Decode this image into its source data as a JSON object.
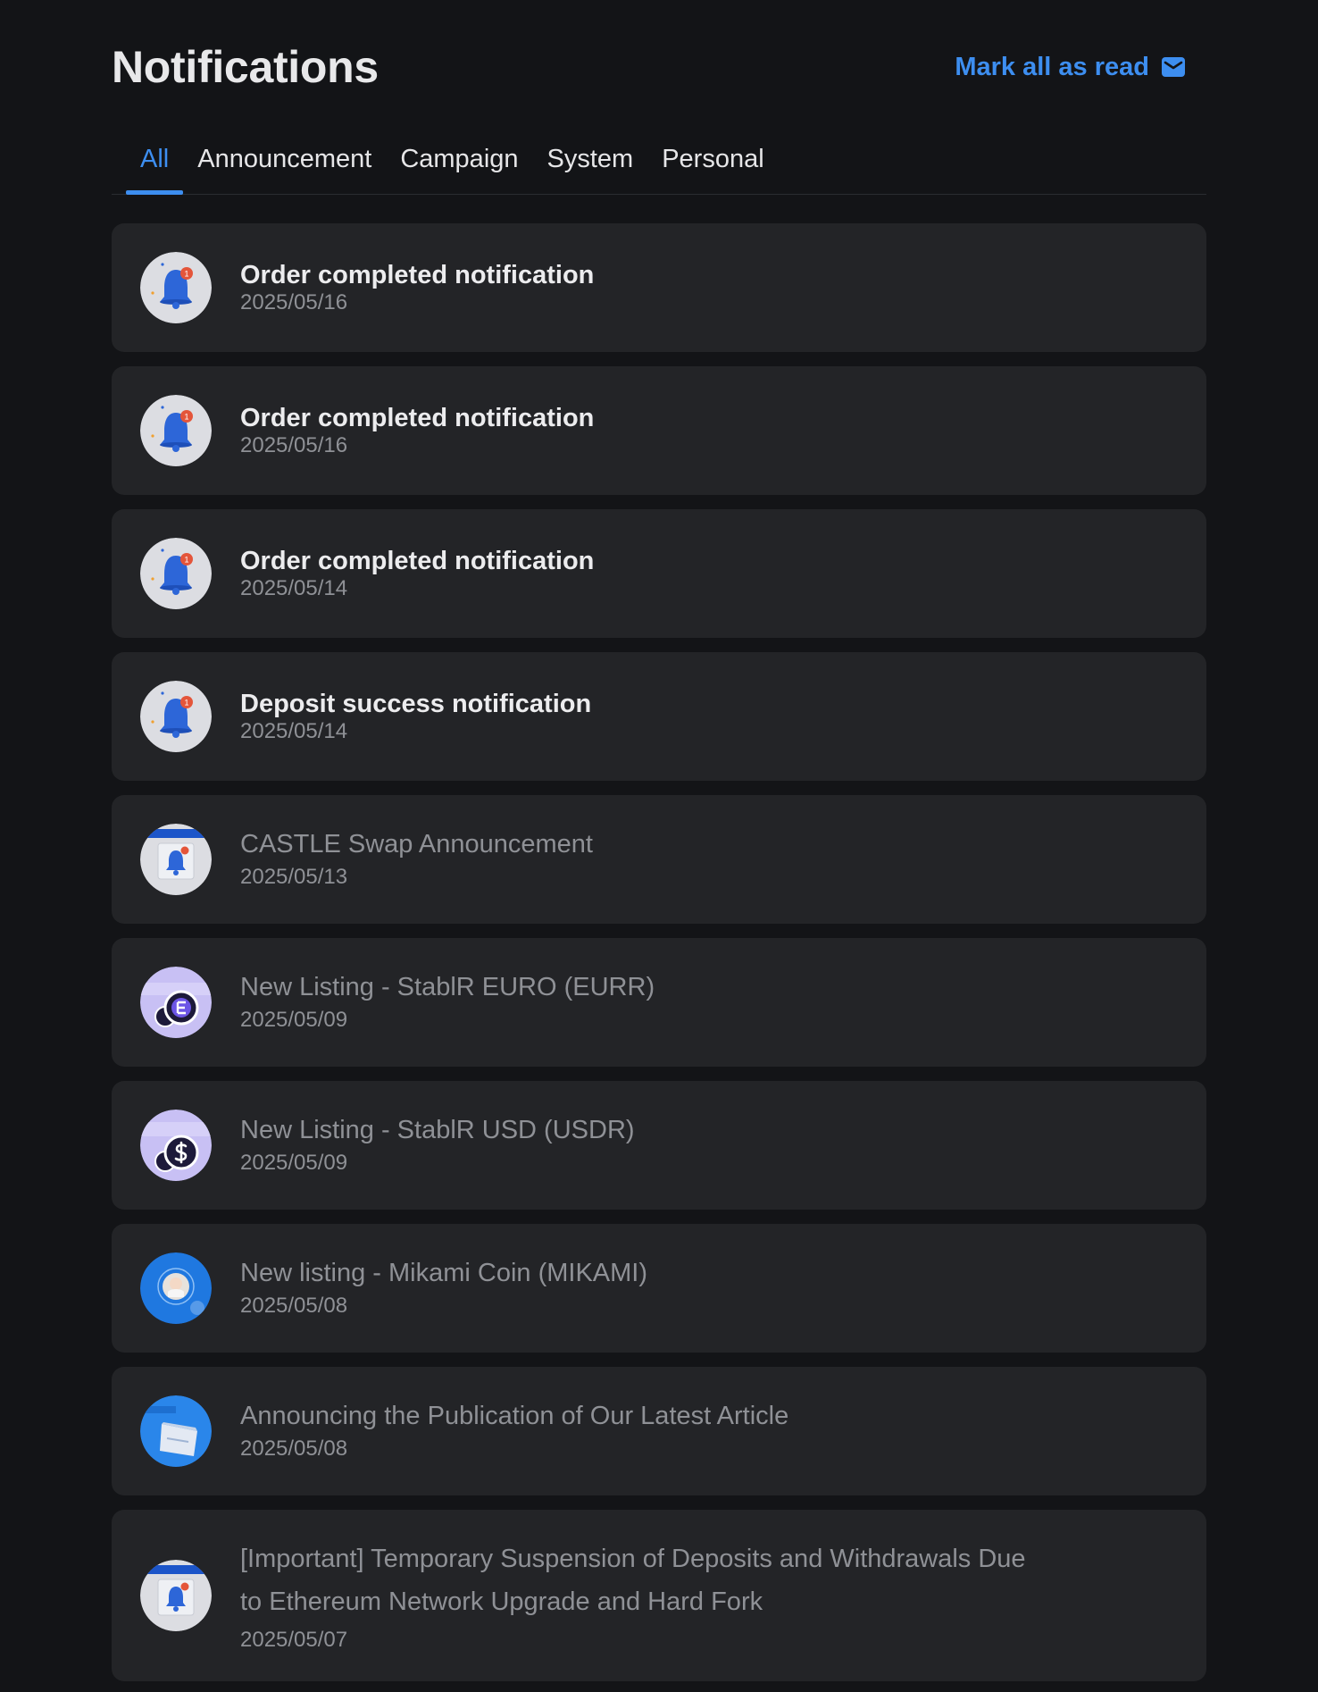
{
  "header": {
    "title": "Notifications",
    "mark_all_label": "Mark all as read",
    "mark_all_icon": "envelope-check-icon"
  },
  "tabs": [
    {
      "label": "All",
      "active": true
    },
    {
      "label": "Announcement",
      "active": false
    },
    {
      "label": "Campaign",
      "active": false
    },
    {
      "label": "System",
      "active": false
    },
    {
      "label": "Personal",
      "active": false
    }
  ],
  "colors": {
    "accent": "#3d8ef0",
    "background": "#131417",
    "card": "#232427",
    "unread_text": "#ececee",
    "read_text": "#8f9196"
  },
  "notifications": [
    {
      "title": "Order completed notification",
      "date": "2025/05/16",
      "unread": true,
      "icon": "bell-icon"
    },
    {
      "title": "Order completed notification",
      "date": "2025/05/16",
      "unread": true,
      "icon": "bell-icon"
    },
    {
      "title": "Order completed notification",
      "date": "2025/05/14",
      "unread": true,
      "icon": "bell-icon"
    },
    {
      "title": "Deposit success notification",
      "date": "2025/05/14",
      "unread": true,
      "icon": "bell-icon"
    },
    {
      "title": "CASTLE Swap Announcement",
      "date": "2025/05/13",
      "unread": false,
      "icon": "announcement-bell-icon"
    },
    {
      "title": "New Listing - StablR EURO (EURR)",
      "date": "2025/05/09",
      "unread": false,
      "icon": "eurr-coin-icon"
    },
    {
      "title": "New Listing - StablR USD (USDR)",
      "date": "2025/05/09",
      "unread": false,
      "icon": "usdr-coin-icon"
    },
    {
      "title": "New listing - Mikami Coin (MIKAMI)",
      "date": "2025/05/08",
      "unread": false,
      "icon": "mikami-coin-icon"
    },
    {
      "title": "Announcing the Publication of Our Latest Article",
      "date": "2025/05/08",
      "unread": false,
      "icon": "article-icon"
    },
    {
      "title": "[Important] Temporary Suspension of Deposits and Withdrawals Due",
      "title_line2": "to Ethereum Network Upgrade and Hard Fork",
      "date": "2025/05/07",
      "unread": false,
      "icon": "announcement-bell-icon"
    }
  ]
}
